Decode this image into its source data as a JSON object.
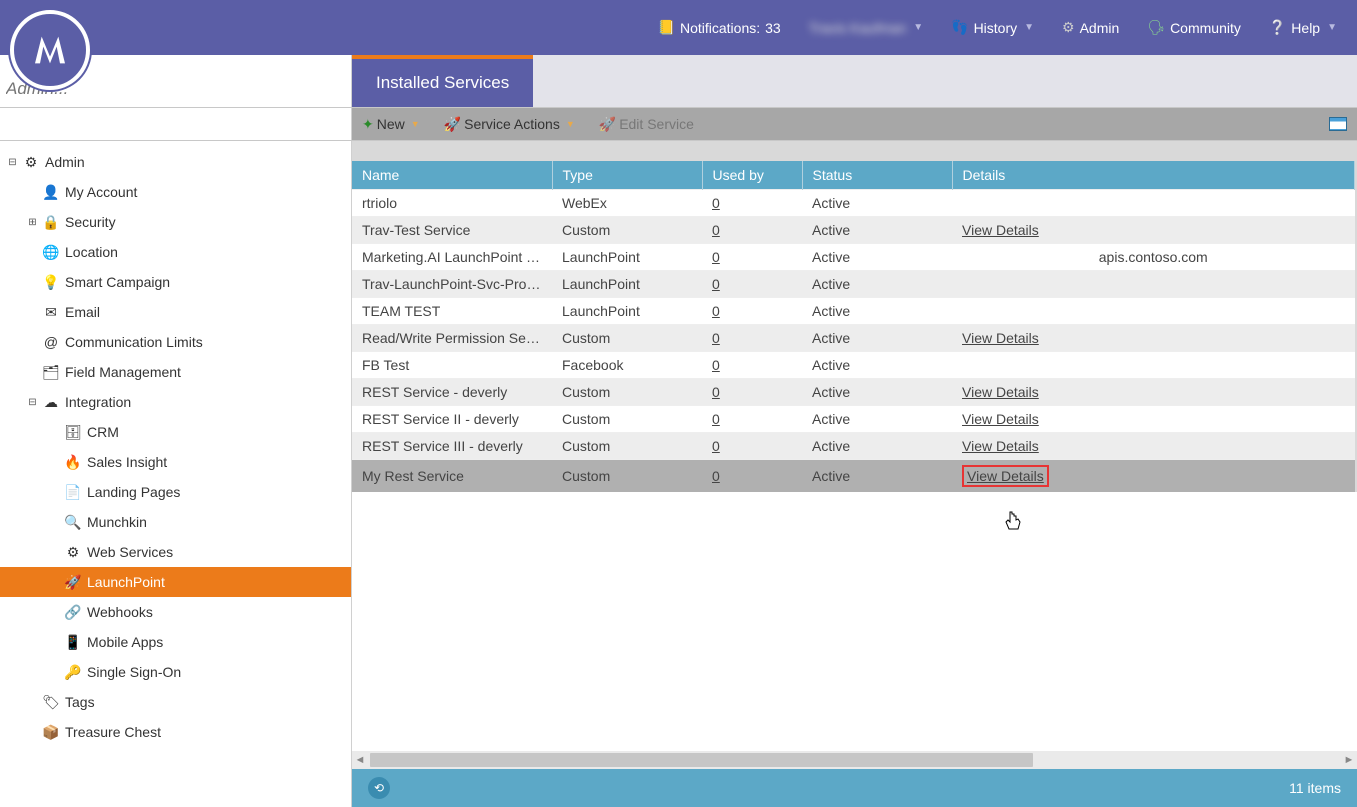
{
  "topbar": {
    "notifications_label": "Notifications:",
    "notifications_count": "33",
    "user": "Travis Kaufman",
    "history": "History",
    "admin": "Admin",
    "community": "Community",
    "help": "Help"
  },
  "sub": {
    "search_placeholder": "Admin...",
    "tab_label": "Installed Services"
  },
  "toolbar": {
    "new": "New",
    "service_actions": "Service Actions",
    "edit_service": "Edit Service"
  },
  "sidebar": {
    "root": "Admin",
    "items": [
      {
        "label": "My Account",
        "icon": "👤",
        "lv": 1
      },
      {
        "label": "Security",
        "icon": "🔒",
        "lv": 1,
        "toggle": "⊞"
      },
      {
        "label": "Location",
        "icon": "🌐",
        "lv": 1
      },
      {
        "label": "Smart Campaign",
        "icon": "💡",
        "lv": 1
      },
      {
        "label": "Email",
        "icon": "✉",
        "lv": 1
      },
      {
        "label": "Communication Limits",
        "icon": "@",
        "lv": 1
      },
      {
        "label": "Field Management",
        "icon": "🗂",
        "lv": 1
      },
      {
        "label": "Integration",
        "icon": "☁",
        "lv": 1,
        "toggle": "⊟"
      },
      {
        "label": "CRM",
        "icon": "🗄",
        "lv": 2
      },
      {
        "label": "Sales Insight",
        "icon": "🔥",
        "lv": 2
      },
      {
        "label": "Landing Pages",
        "icon": "📄",
        "lv": 2
      },
      {
        "label": "Munchkin",
        "icon": "🔍",
        "lv": 2
      },
      {
        "label": "Web Services",
        "icon": "⚙",
        "lv": 2
      },
      {
        "label": "LaunchPoint",
        "icon": "🚀",
        "lv": 2,
        "active": true
      },
      {
        "label": "Webhooks",
        "icon": "🔗",
        "lv": 2
      },
      {
        "label": "Mobile Apps",
        "icon": "📱",
        "lv": 2
      },
      {
        "label": "Single Sign-On",
        "icon": "🔑",
        "lv": 2
      },
      {
        "label": "Tags",
        "icon": "🏷",
        "lv": 1
      },
      {
        "label": "Treasure Chest",
        "icon": "📦",
        "lv": 1
      }
    ]
  },
  "grid": {
    "headers": {
      "name": "Name",
      "type": "Type",
      "used": "Used by",
      "status": "Status",
      "details": "Details"
    },
    "rows": [
      {
        "name": "rtriolo",
        "type": "WebEx",
        "used": "0",
        "status": "Active",
        "details": ""
      },
      {
        "name": "Trav-Test Service",
        "type": "Custom",
        "used": "0",
        "status": "Active",
        "details": "View Details"
      },
      {
        "name": "Marketing.AI LaunchPoint Te...",
        "type": "LaunchPoint",
        "used": "0",
        "status": "Active",
        "details": "apis.contoso.com"
      },
      {
        "name": "Trav-LaunchPoint-Svc-Prog-I...",
        "type": "LaunchPoint",
        "used": "0",
        "status": "Active",
        "details": ""
      },
      {
        "name": "TEAM TEST",
        "type": "LaunchPoint",
        "used": "0",
        "status": "Active",
        "details": ""
      },
      {
        "name": "Read/Write Permission Servi...",
        "type": "Custom",
        "used": "0",
        "status": "Active",
        "details": "View Details"
      },
      {
        "name": "FB Test",
        "type": "Facebook",
        "used": "0",
        "status": "Active",
        "details": ""
      },
      {
        "name": "REST Service - deverly",
        "type": "Custom",
        "used": "0",
        "status": "Active",
        "details": "View Details"
      },
      {
        "name": "REST Service II - deverly",
        "type": "Custom",
        "used": "0",
        "status": "Active",
        "details": "View Details"
      },
      {
        "name": "REST Service III - deverly",
        "type": "Custom",
        "used": "0",
        "status": "Active",
        "details": "View Details"
      },
      {
        "name": "My Rest Service",
        "type": "Custom",
        "used": "0",
        "status": "Active",
        "details": "View Details",
        "selected": true,
        "highlight": true
      }
    ],
    "footer_count": "11 items"
  }
}
